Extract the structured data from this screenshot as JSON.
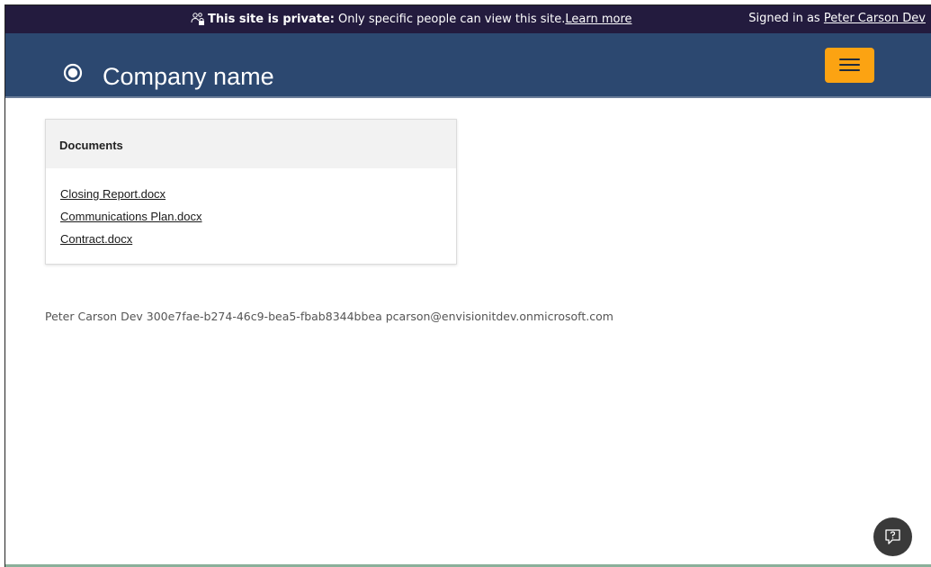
{
  "privacy_bar": {
    "label_bold": "This site is private:",
    "message": "Only specific people can view this site.",
    "learn_more": "Learn more",
    "signed_in_prefix": "Signed in as",
    "user_name": "Peter Carson Dev",
    "background": "#231b3e"
  },
  "header": {
    "company_name": "Company name",
    "background": "#2c4870",
    "menu_button_color": "#fca312",
    "logo_icon": "ring-logo-icon",
    "menu_icon": "hamburger-icon"
  },
  "documents": {
    "title": "Documents",
    "items": [
      {
        "label": "Closing Report.docx"
      },
      {
        "label": "Communications Plan.docx"
      },
      {
        "label": "Contract.docx"
      }
    ]
  },
  "user_info": "Peter Carson Dev 300e7fae-b274-46c9-bea5-fbab8344bbea pcarson@envisionitdev.onmicrosoft.com",
  "help_button": {
    "icon": "chat-help-icon"
  }
}
